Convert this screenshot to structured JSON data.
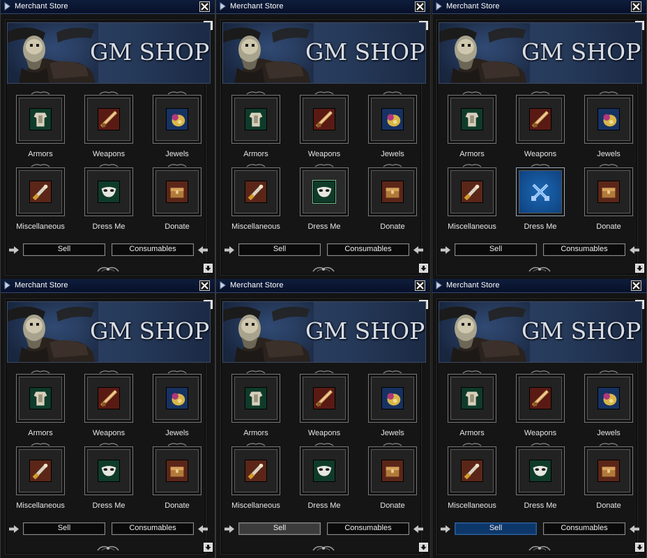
{
  "window_title": "Merchant Store",
  "banner_title": "GM SHOP",
  "categories": [
    {
      "label": "Armors",
      "icon": "armor-icon"
    },
    {
      "label": "Weapons",
      "icon": "weapon-icon"
    },
    {
      "label": "Jewels",
      "icon": "jewel-icon"
    },
    {
      "label": "Miscellaneous",
      "icon": "miscellaneous-icon"
    },
    {
      "label": "Dress Me",
      "icon": "mask-icon"
    },
    {
      "label": "Donate",
      "icon": "chest-icon"
    }
  ],
  "buttons": {
    "sell": "Sell",
    "consumables": "Consumables"
  },
  "panels": [
    {
      "state": "default",
      "hovered_category": null,
      "selected_category": null,
      "sell_state": "normal"
    },
    {
      "state": "dress-me-hover",
      "hovered_category": "Dress Me",
      "selected_category": null,
      "sell_state": "normal"
    },
    {
      "state": "dress-me-selected",
      "hovered_category": null,
      "selected_category": "Dress Me",
      "selected_icon": "crossed-swords-icon",
      "sell_state": "normal"
    },
    {
      "state": "default",
      "hovered_category": null,
      "selected_category": null,
      "sell_state": "normal"
    },
    {
      "state": "sell-hover",
      "hovered_category": null,
      "selected_category": null,
      "sell_state": "hover"
    },
    {
      "state": "sell-active",
      "hovered_category": null,
      "selected_category": null,
      "sell_state": "active"
    }
  ],
  "colors": {
    "titlebar": "#0a1530",
    "selected_slot": "#1b67b3",
    "sell_active": "#0e3769"
  }
}
